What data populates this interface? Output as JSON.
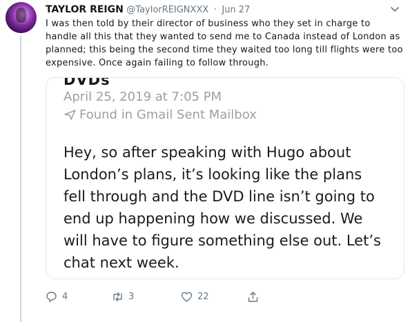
{
  "tweet": {
    "display_name": "TAYLOR REIGN",
    "handle": "@TaylorREIGNXXX",
    "separator": "·",
    "date": "Jun 27",
    "text": "I was then told by their director of business who they set in charge to handle all this that they wanted to send me to Canada instead of London as planned; this being the second time they waited too long till flights were too expensive. Once again failing to follow through."
  },
  "quote": {
    "subject_cut": "DVDs",
    "date": "April 25, 2019 at 7:05 PM",
    "source": "Found in Gmail Sent Mailbox",
    "body": "Hey, so after speaking with Hugo about London’s plans, it’s looking like the plans fell through and the DVD line isn’t going to end up happening how we discussed. We will have to figure something else out. Let’s chat next week."
  },
  "actions": {
    "replies": "4",
    "retweets": "3",
    "likes": "22"
  },
  "icons": {
    "reply": "reply-icon",
    "retweet": "retweet-icon",
    "like": "heart-icon",
    "share": "share-icon",
    "sent": "sent-arrow-icon",
    "menu": "chevron-down-icon"
  },
  "colors": {
    "text": "#14171a",
    "muted": "#657786",
    "quote_muted": "#9aa0a6",
    "border": "#e1e8ed",
    "thread_line": "#ccd6dd"
  }
}
